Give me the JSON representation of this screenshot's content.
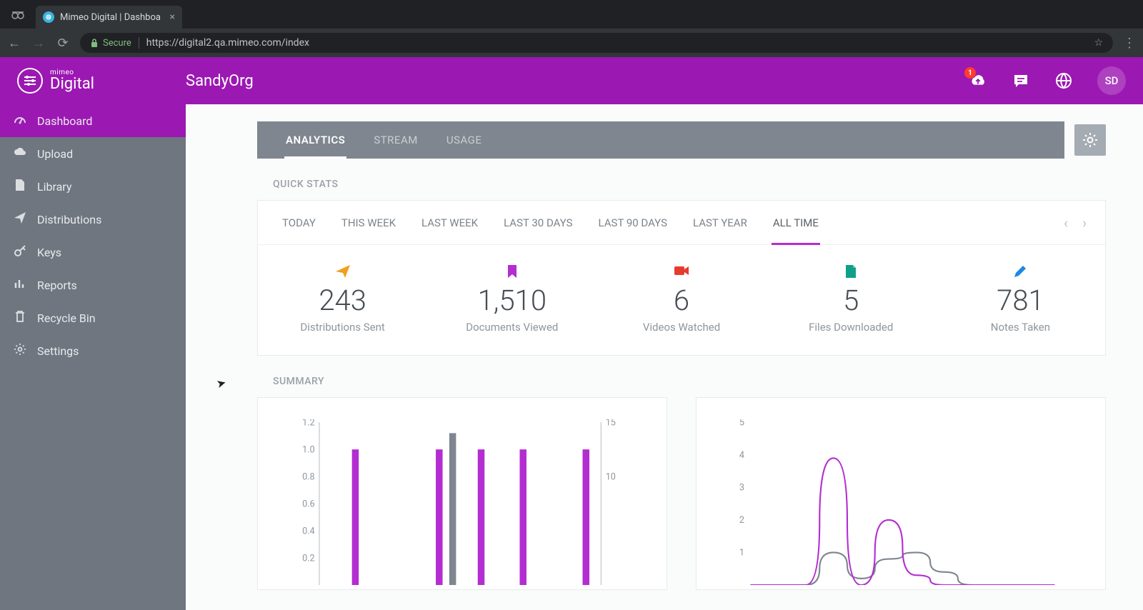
{
  "browser": {
    "tab_title": "Mimeo Digital | Dashboa",
    "secure_label": "Secure",
    "url": "https://digital2.qa.mimeo.com/index"
  },
  "header": {
    "brand_pretitle": "mimeo",
    "brand_title": "Digital",
    "org_name": "SandyOrg",
    "notification_count": "1",
    "avatar_initials": "SD"
  },
  "sidebar": {
    "items": [
      {
        "icon": "gauge-icon",
        "label": "Dashboard",
        "active": true
      },
      {
        "icon": "cloud-upload-icon",
        "label": "Upload"
      },
      {
        "icon": "file-icon",
        "label": "Library"
      },
      {
        "icon": "send-icon",
        "label": "Distributions"
      },
      {
        "icon": "key-icon",
        "label": "Keys"
      },
      {
        "icon": "bar-chart-icon",
        "label": "Reports"
      },
      {
        "icon": "trash-icon",
        "label": "Recycle Bin"
      },
      {
        "icon": "gear-icon",
        "label": "Settings"
      }
    ]
  },
  "main": {
    "tabs": [
      {
        "label": "ANALYTICS",
        "active": true
      },
      {
        "label": "STREAM"
      },
      {
        "label": "USAGE"
      }
    ],
    "quick_stats_label": "QUICK STATS",
    "periods": [
      {
        "label": "TODAY"
      },
      {
        "label": "THIS WEEK"
      },
      {
        "label": "LAST WEEK"
      },
      {
        "label": "LAST 30 DAYS"
      },
      {
        "label": "LAST 90 DAYS"
      },
      {
        "label": "LAST YEAR"
      },
      {
        "label": "ALL TIME",
        "active": true
      }
    ],
    "stats": [
      {
        "icon": "paper-plane-icon",
        "color": "#f0a020",
        "value": "243",
        "label": "Distributions Sent"
      },
      {
        "icon": "bookmark-icon",
        "color": "#b32dd1",
        "value": "1,510",
        "label": "Documents Viewed"
      },
      {
        "icon": "video-icon",
        "color": "#e63b2e",
        "value": "6",
        "label": "Videos Watched"
      },
      {
        "icon": "file-download-icon",
        "color": "#0fa08a",
        "value": "5",
        "label": "Files Downloaded"
      },
      {
        "icon": "pencil-icon",
        "color": "#1e88e5",
        "value": "781",
        "label": "Notes Taken"
      }
    ],
    "summary_label": "SUMMARY"
  },
  "chart_data": [
    {
      "type": "bar",
      "y_left_label": "",
      "y_right_label": "",
      "y_left_ticks": [
        0.2,
        0.4,
        0.6,
        0.8,
        1.0,
        1.2
      ],
      "y_right_ticks": [
        10,
        15
      ],
      "series": [
        {
          "name": "magenta",
          "values": [
            0,
            1.0,
            0,
            0,
            0,
            1.0,
            0,
            1.0,
            0,
            1.0,
            0,
            0,
            1.0
          ]
        },
        {
          "name": "grey",
          "values": [
            0,
            0,
            0,
            0,
            0,
            0,
            14,
            0,
            0,
            0,
            0,
            0,
            0
          ]
        }
      ],
      "ylim_left": [
        0,
        1.2
      ],
      "ylim_right": [
        0,
        15
      ]
    },
    {
      "type": "line",
      "y_ticks": [
        1,
        2,
        3,
        4,
        5
      ],
      "series": [
        {
          "name": "magenta",
          "values": [
            0,
            0,
            0,
            3.9,
            0,
            2.0,
            0.3,
            0,
            0,
            0,
            0,
            0
          ]
        },
        {
          "name": "grey",
          "values": [
            0,
            0,
            0,
            1.0,
            0.2,
            0.8,
            1.0,
            0.4,
            0,
            0,
            0,
            0
          ]
        }
      ],
      "ylim": [
        0,
        5
      ]
    }
  ]
}
